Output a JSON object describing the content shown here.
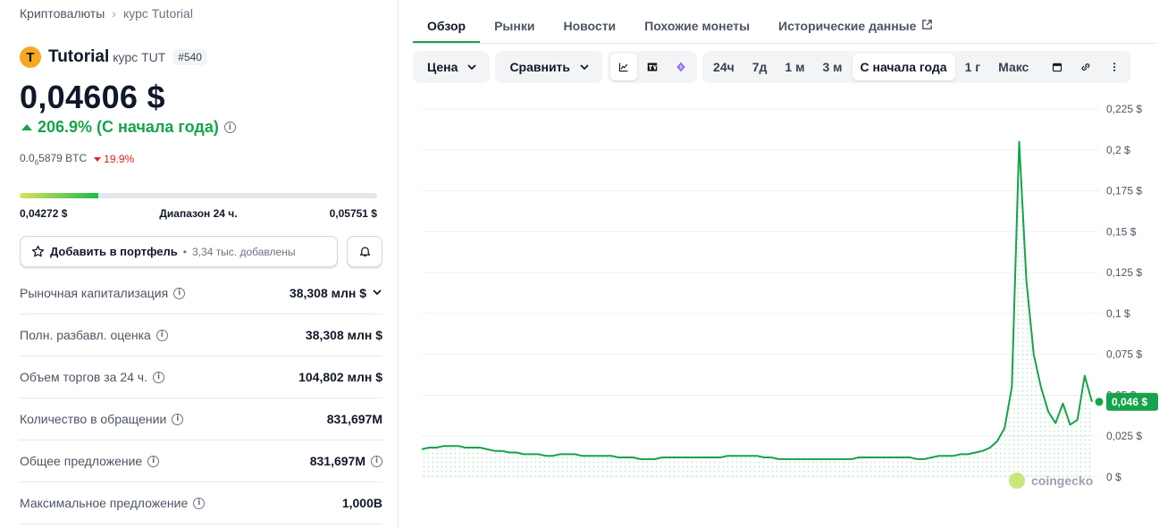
{
  "breadcrumb": {
    "root": "Криптовалюты",
    "current": "курс Tutorial"
  },
  "coin": {
    "logo_letter": "T",
    "name": "Tutorial",
    "symbol_label": "курс TUT",
    "rank": "#540"
  },
  "price": {
    "value": "0,04606 $",
    "change": "206.9% (С начала года)",
    "btc_prefix": "0.0",
    "btc_sub": "6",
    "btc_rest": "5879 BTC",
    "btc_change": "19.9%"
  },
  "range": {
    "low": "0,04272 $",
    "label": "Диапазон 24 ч.",
    "high": "0,05751 $",
    "fill": 0.22
  },
  "portfolio": {
    "label": "Добавить в портфель",
    "sep": "•",
    "added": "3,34 тыс. добавлены"
  },
  "stats": [
    {
      "label": "Рыночная капитализация",
      "value": "38,308 млн $",
      "extra": "chevron"
    },
    {
      "label": "Полн. разбавл. оценка",
      "value": "38,308 млн $"
    },
    {
      "label": "Объем торгов за 24 ч.",
      "value": "104,802 млн $"
    },
    {
      "label": "Количество в обращении",
      "value": "831,697M"
    },
    {
      "label": "Общее предложение",
      "value": "831,697M",
      "extra": "info"
    },
    {
      "label": "Максимальное предложение",
      "value": "1,000B"
    }
  ],
  "tabs": [
    "Обзор",
    "Рынки",
    "Новости",
    "Похожие монеты",
    "Исторические данные"
  ],
  "toolbar": {
    "price_dd": "Цена",
    "compare_dd": "Сравнить",
    "chart_icons": [
      "line-chart-icon",
      "tradingview-icon",
      "diamond-icon"
    ],
    "ranges": [
      "24ч",
      "7д",
      "1 м",
      "3 м",
      "С начала года",
      "1 г",
      "Макс"
    ],
    "selected_range": "С начала года",
    "right_icons": [
      "calendar-icon",
      "link-icon",
      "more-icon"
    ]
  },
  "colors": {
    "accent": "#16a34a",
    "down": "#dc2626",
    "line": "#16a34a"
  },
  "chart_data": {
    "type": "line",
    "y_ticks": [
      "0,225 $",
      "0,2 $",
      "0,175 $",
      "0,15 $",
      "0,125 $",
      "0,1 $",
      "0,075 $",
      "0,05 $",
      "0,025 $",
      "0 $"
    ],
    "ylim": [
      0,
      0.225
    ],
    "current_label": "0,046 $",
    "watermark": "coingecko",
    "values": [
      0.017,
      0.018,
      0.018,
      0.019,
      0.019,
      0.019,
      0.018,
      0.018,
      0.018,
      0.017,
      0.016,
      0.016,
      0.015,
      0.015,
      0.014,
      0.014,
      0.014,
      0.013,
      0.013,
      0.014,
      0.014,
      0.014,
      0.013,
      0.013,
      0.013,
      0.013,
      0.013,
      0.012,
      0.012,
      0.012,
      0.011,
      0.011,
      0.011,
      0.012,
      0.012,
      0.012,
      0.012,
      0.012,
      0.012,
      0.012,
      0.012,
      0.012,
      0.013,
      0.013,
      0.013,
      0.013,
      0.013,
      0.012,
      0.012,
      0.011,
      0.011,
      0.011,
      0.011,
      0.011,
      0.011,
      0.011,
      0.011,
      0.011,
      0.011,
      0.011,
      0.012,
      0.012,
      0.012,
      0.012,
      0.012,
      0.012,
      0.012,
      0.012,
      0.011,
      0.011,
      0.012,
      0.013,
      0.013,
      0.013,
      0.014,
      0.014,
      0.015,
      0.016,
      0.018,
      0.022,
      0.03,
      0.055,
      0.205,
      0.12,
      0.075,
      0.055,
      0.04,
      0.033,
      0.045,
      0.032,
      0.035,
      0.062,
      0.046
    ]
  }
}
